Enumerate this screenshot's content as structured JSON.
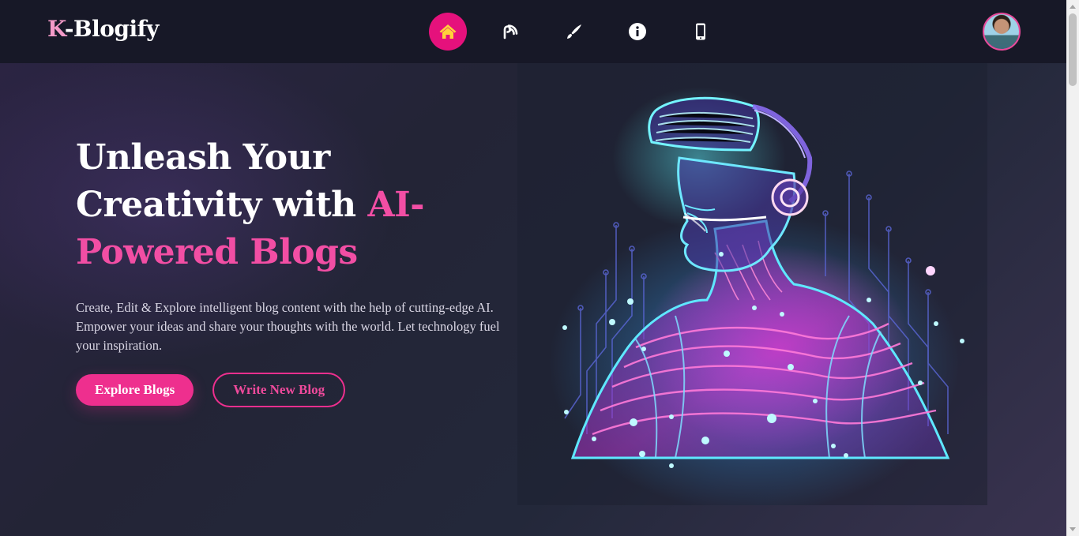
{
  "brand": {
    "initial": "K",
    "rest": "-Blogify"
  },
  "nav": {
    "items": [
      {
        "icon": "home-icon",
        "active": true
      },
      {
        "icon": "blog-icon",
        "active": false
      },
      {
        "icon": "pen-icon",
        "active": false
      },
      {
        "icon": "info-icon",
        "active": false
      },
      {
        "icon": "mobile-icon",
        "active": false
      }
    ],
    "active_color": "#e5117c"
  },
  "hero": {
    "title_line1": "Unleash Your",
    "title_line2_white": "Creativity with ",
    "title_line2_accent": "AI-",
    "title_line3_accent": "Powered Blogs",
    "subtitle": "Create, Edit & Explore intelligent blog content with the help of cutting-edge AI. Empower your ideas and share your thoughts with the world. Let technology fuel your inspiration.",
    "primary_button": "Explore Blogs",
    "secondary_button": "Write New Blog",
    "accent_color": "#ee2f8e"
  }
}
